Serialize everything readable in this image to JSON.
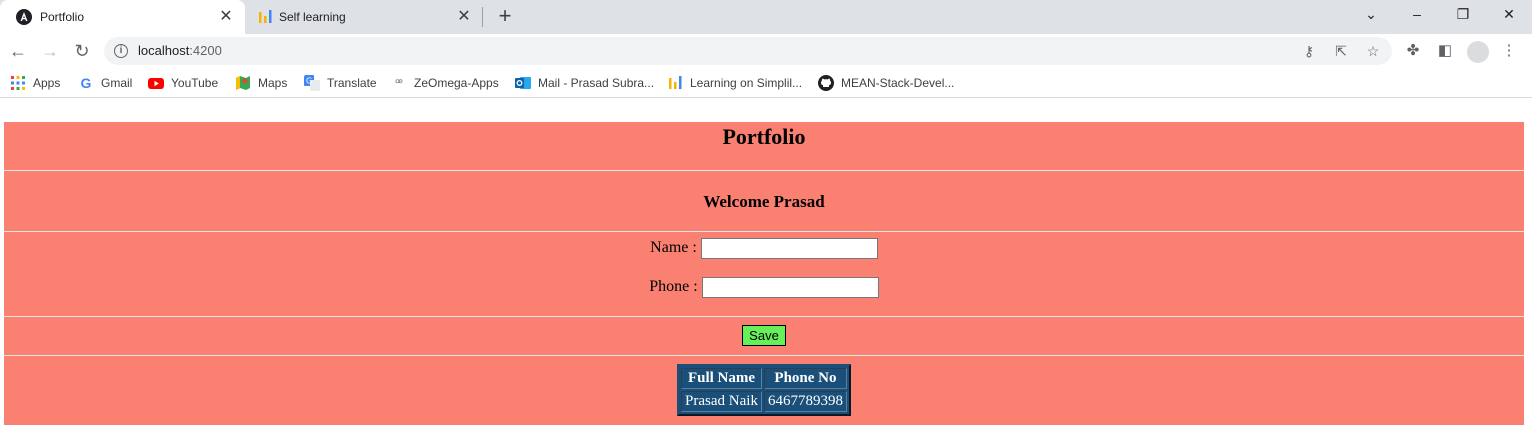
{
  "browser": {
    "tabs": [
      {
        "title": "Portfolio",
        "active": true,
        "icon": "angular-icon"
      },
      {
        "title": "Self learning",
        "active": false,
        "icon": "bar-chart-icon"
      }
    ],
    "address": {
      "host": "localhost",
      "port": ":4200"
    },
    "bookmarks": [
      {
        "label": "Apps",
        "icon": "apps-grid-icon"
      },
      {
        "label": "Gmail",
        "icon": "google-icon"
      },
      {
        "label": "YouTube",
        "icon": "youtube-icon"
      },
      {
        "label": "Maps",
        "icon": "maps-icon"
      },
      {
        "label": "Translate",
        "icon": "translate-icon"
      },
      {
        "label": "ZeOmega-Apps",
        "icon": "zeomega-icon"
      },
      {
        "label": "Mail - Prasad Subra...",
        "icon": "outlook-icon"
      },
      {
        "label": "Learning on Simplil...",
        "icon": "bar-chart-icon"
      },
      {
        "label": "MEAN-Stack-Devel...",
        "icon": "github-icon"
      }
    ]
  },
  "page": {
    "title": "Portfolio",
    "welcome": "Welcome Prasad",
    "form": {
      "name_label": "Name :",
      "name_value": "",
      "phone_label": "Phone :",
      "phone_value": "",
      "save_label": "Save"
    },
    "table": {
      "headers": [
        "Full Name",
        "Phone No"
      ],
      "rows": [
        [
          "Prasad Naik",
          "6467789398"
        ]
      ]
    }
  },
  "colors": {
    "page_background": "#fa8072",
    "table_background": "#1a4f7a",
    "save_button": "#66f05a"
  }
}
